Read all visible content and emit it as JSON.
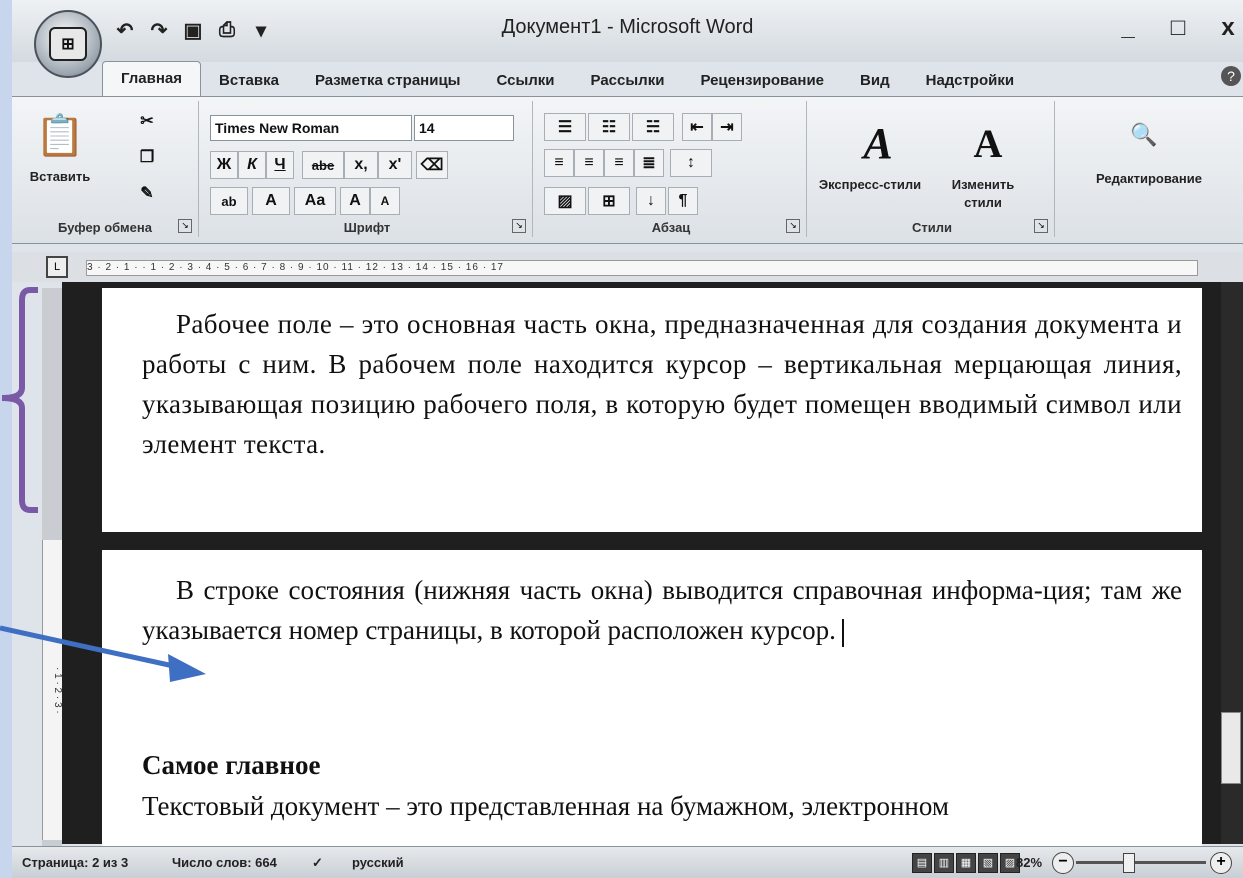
{
  "window": {
    "title": "Документ1 - Microsoft Word",
    "controls": {
      "minimize": "_",
      "maximize": "□",
      "close": "x"
    }
  },
  "quick_access": {
    "undo": "↶",
    "redo": "↷",
    "save": "▣",
    "print": "⎙",
    "more": "▾"
  },
  "tabs": [
    {
      "label": "Главная",
      "active": true
    },
    {
      "label": "Вставка"
    },
    {
      "label": "Разметка страницы"
    },
    {
      "label": "Ссылки"
    },
    {
      "label": "Рассылки"
    },
    {
      "label": "Рецензирование"
    },
    {
      "label": "Вид"
    },
    {
      "label": "Надстройки"
    }
  ],
  "ribbon": {
    "clipboard": {
      "label": "Буфер обмена",
      "paste": "Вставить",
      "cut": "✂",
      "copy": "❐",
      "format_painter": "✎"
    },
    "font": {
      "label": "Шрифт",
      "name": "Times New Roman",
      "size": "14",
      "bold": "Ж",
      "italic": "К",
      "underline": "Ч",
      "strike": "abe",
      "subscript": "x,",
      "superscript": "x'",
      "clear": "⌫",
      "highlight": "ab",
      "color": "A",
      "case": "Aa",
      "grow": "A",
      "shrink": "A"
    },
    "paragraph": {
      "label": "Абзац",
      "bullets": "☰",
      "numbering": "☷",
      "multilevel": "☵",
      "indent_dec": "⇤",
      "indent_inc": "⇥",
      "align_left": "≡",
      "align_center": "≡",
      "align_right": "≡",
      "justify": "≣",
      "line_spacing": "↕",
      "shading": "▨",
      "borders": "⊞",
      "sort": "↓",
      "show_marks": "¶"
    },
    "styles": {
      "label": "Стили",
      "express": "Экспресс-стили",
      "change": "Изменить",
      "change2": "стили"
    },
    "editing": {
      "label": "Редактирование"
    }
  },
  "ruler": {
    "text": "3 · 2 · 1 · · 1 · 2 · 3 · 4 · 5 · 6 · 7 · 8 · 9 · 10 · 11 · 12 · 13 · 14 · 15 · 16 · 17"
  },
  "document": {
    "page1_text": "Рабочее поле – это основная часть окна, предназначенная для создания документа и работы с ним. В рабочем поле находится курсор – вертикальная мерцающая линия, указывающая позицию рабочего поля, в которую будет помещен вводимый символ или элемент текста.",
    "page2_text": "В строке состояния (нижняя часть окна) выводится справочная информа-ция; там же указывается номер страницы, в которой расположен курсор.",
    "heading": "Самое главное",
    "page2_text2": "Текстовый документ – это представленная на бумажном, электронном"
  },
  "status": {
    "page": "Страница: 2 из 3",
    "words": "Число слов: 664",
    "language": "русский",
    "zoom": "82%",
    "zoom_out": "−",
    "zoom_in": "+",
    "zoom_percent": 82
  },
  "colors": {
    "bracket": "#7a5aa6",
    "arrow": "#3f6fc2"
  }
}
